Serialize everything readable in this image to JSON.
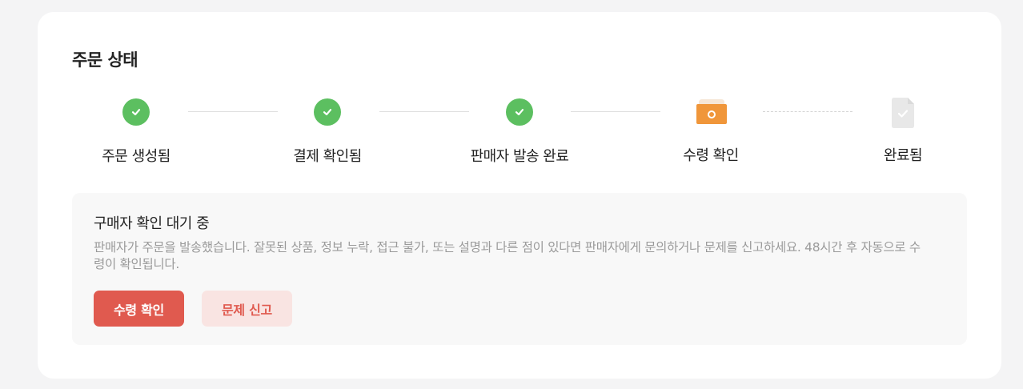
{
  "title": "주문 상태",
  "steps": [
    {
      "label": "주문 생성됨",
      "status": "done",
      "icon": "check-circle-icon"
    },
    {
      "label": "결제 확인됨",
      "status": "done",
      "icon": "check-circle-icon"
    },
    {
      "label": "판매자 발송 완료",
      "status": "done",
      "icon": "check-circle-icon"
    },
    {
      "label": "수령 확인",
      "status": "current",
      "icon": "package-icon"
    },
    {
      "label": "완료됨",
      "status": "pending",
      "icon": "document-check-icon"
    }
  ],
  "notice": {
    "title": "구매자 확인 대기 중",
    "description": "판매자가 주문을 발송했습니다. 잘못된 상품, 정보 누락, 접근 불가, 또는 설명과 다른 점이 있다면 판매자에게 문의하거나 문제를 신고하세요. 48시간 후 자동으로 수령이 확인됩니다.",
    "primary_button": "수령 확인",
    "secondary_button": "문제 신고"
  },
  "colors": {
    "done": "#5cbf60",
    "current": "#f0963a",
    "pending": "#e6e6e6",
    "accent": "#e05a4f",
    "accent_soft": "#f9e4e2"
  }
}
